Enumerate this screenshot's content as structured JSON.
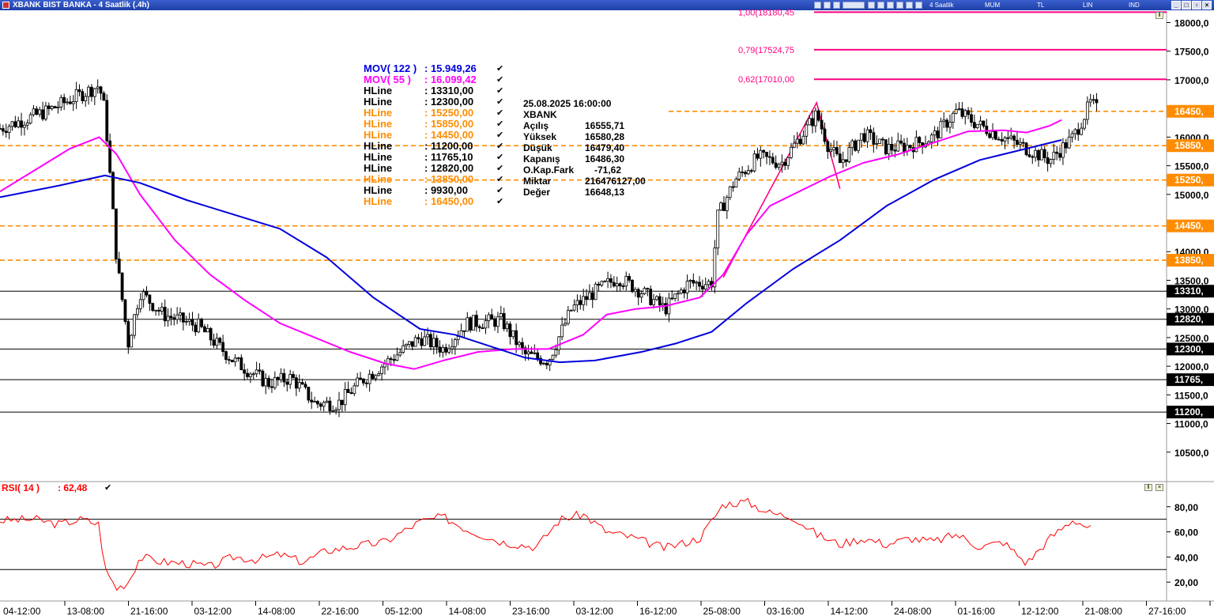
{
  "window": {
    "title": "XBANK BIST BANKA - 4 Saatlik (.4h)",
    "toolbar": [
      "4 Saatlik",
      "MUM",
      "TL",
      "LIN",
      "IND"
    ]
  },
  "colors": {
    "mov122": "#0000dd",
    "mov55": "#ff00ff",
    "hline_black": "#000000",
    "hline_orange": "#ff8c00",
    "fib": "#ff0080",
    "rsi": "#ff0000",
    "candle_up": "#ffffff",
    "candle_down": "#000000"
  },
  "legend": {
    "mov122_label": "MOV( 122 )",
    "mov122_value": ": 15.949,26",
    "mov55_label": "MOV( 55 )",
    "mov55_value": ": 16.099,42",
    "hlines": [
      {
        "label": "HLine",
        "value": ": 13310,00",
        "color": "black"
      },
      {
        "label": "HLine",
        "value": ": 12300,00",
        "color": "black"
      },
      {
        "label": "HLine",
        "value": ": 15250,00",
        "color": "orange"
      },
      {
        "label": "HLine",
        "value": ": 15850,00",
        "color": "orange"
      },
      {
        "label": "HLine",
        "value": ": 14450,00",
        "color": "orange"
      },
      {
        "label": "HLine",
        "value": ": 11200,00",
        "color": "black"
      },
      {
        "label": "HLine",
        "value": ": 11765,10",
        "color": "black"
      },
      {
        "label": "HLine",
        "value": ": 12820,00",
        "color": "black"
      },
      {
        "label": "HLine",
        "value": ": 13850,00",
        "color": "orange"
      },
      {
        "label": "HLine",
        "value": ": 9930,00",
        "color": "black"
      },
      {
        "label": "HLine",
        "value": ": 16450,00",
        "color": "orange"
      }
    ]
  },
  "info": {
    "datetime": "25.08.2025  16:00:00",
    "symbol": "XBANK",
    "rows": [
      {
        "label": "Açılış",
        "value": "16555,71"
      },
      {
        "label": "Yüksek",
        "value": "16580,28"
      },
      {
        "label": "Düşük",
        "value": "16479,40"
      },
      {
        "label": "Kapanış",
        "value": "16486,30"
      },
      {
        "label": "O.Kap.Fark",
        "value": "-71,62"
      },
      {
        "label": "Miktar",
        "value": "216476127,00"
      },
      {
        "label": "Değer",
        "value": "16648,13"
      }
    ]
  },
  "rsi": {
    "label": "RSI( 14 )",
    "value": ": 62,48"
  },
  "chart_data": {
    "type": "candlestick",
    "price_axis": {
      "min": 10000,
      "max": 18200,
      "ticks": [
        {
          "value": 18000,
          "label": "18000,0"
        },
        {
          "value": 17500,
          "label": "17500,0"
        },
        {
          "value": 17000,
          "label": "17000,0"
        },
        {
          "value": 16500,
          "label": "16500,0"
        },
        {
          "value": 16000,
          "label": "16000,0"
        },
        {
          "value": 15500,
          "label": "15500,0"
        },
        {
          "value": 15000,
          "label": "15000,0"
        },
        {
          "value": 14500,
          "label": "14500,0"
        },
        {
          "value": 14000,
          "label": "14000,0"
        },
        {
          "value": 13500,
          "label": "13500,0"
        },
        {
          "value": 13000,
          "label": "13000,0"
        },
        {
          "value": 12500,
          "label": "12500,0"
        },
        {
          "value": 12000,
          "label": "12000,0"
        },
        {
          "value": 11500,
          "label": "11500,0"
        },
        {
          "value": 11000,
          "label": "11000,0"
        },
        {
          "value": 10500,
          "label": "10500,0"
        }
      ]
    },
    "x_labels": [
      "04-12:00",
      "13-08:00",
      "21-16:00",
      "03-12:00",
      "14-08:00",
      "22-16:00",
      "05-12:00",
      "14-08:00",
      "23-16:00",
      "03-12:00",
      "16-12:00",
      "25-08:00",
      "03-16:00",
      "14-12:00",
      "24-08:00",
      "01-16:00",
      "12-12:00",
      "21-08:00",
      "27-16:00"
    ],
    "horizontal_lines": [
      {
        "value": 16450,
        "label": "16450,",
        "color": "orange"
      },
      {
        "value": 15850,
        "label": "15850,",
        "color": "orange"
      },
      {
        "value": 15250,
        "label": "15250,",
        "color": "orange"
      },
      {
        "value": 14450,
        "label": "14450,",
        "color": "orange"
      },
      {
        "value": 13850,
        "label": "13850,",
        "color": "orange"
      },
      {
        "value": 13310,
        "label": "13310,",
        "color": "black"
      },
      {
        "value": 12820,
        "label": "12820,",
        "color": "black"
      },
      {
        "value": 12300,
        "label": "12300,",
        "color": "black"
      },
      {
        "value": 11765.1,
        "label": "11765,",
        "color": "black"
      },
      {
        "value": 11200,
        "label": "11200,",
        "color": "black"
      }
    ],
    "fibonacci": [
      {
        "value": 18180.45,
        "label": "1,00(18180,45"
      },
      {
        "value": 17524.75,
        "label": "0,79(17524,75"
      },
      {
        "value": 17010,
        "label": "0,62(17010,00"
      }
    ],
    "close_path": [
      [
        0,
        16150
      ],
      [
        0.04,
        16450
      ],
      [
        0.07,
        16750
      ],
      [
        0.085,
        16900
      ],
      [
        0.09,
        16450
      ],
      [
        0.1,
        13850
      ],
      [
        0.11,
        12400
      ],
      [
        0.12,
        13300
      ],
      [
        0.14,
        12900
      ],
      [
        0.17,
        12700
      ],
      [
        0.2,
        12100
      ],
      [
        0.23,
        11700
      ],
      [
        0.25,
        11800
      ],
      [
        0.27,
        11350
      ],
      [
        0.29,
        11350
      ],
      [
        0.31,
        11750
      ],
      [
        0.34,
        12200
      ],
      [
        0.36,
        12500
      ],
      [
        0.38,
        12300
      ],
      [
        0.4,
        12750
      ],
      [
        0.43,
        12800
      ],
      [
        0.45,
        12200
      ],
      [
        0.47,
        12100
      ],
      [
        0.49,
        13000
      ],
      [
        0.51,
        13300
      ],
      [
        0.53,
        13550
      ],
      [
        0.55,
        13300
      ],
      [
        0.57,
        13000
      ],
      [
        0.59,
        13450
      ],
      [
        0.61,
        13450
      ],
      [
        0.615,
        14600
      ],
      [
        0.63,
        15250
      ],
      [
        0.65,
        15650
      ],
      [
        0.67,
        15550
      ],
      [
        0.7,
        16400
      ],
      [
        0.71,
        15850
      ],
      [
        0.72,
        15550
      ],
      [
        0.74,
        16050
      ],
      [
        0.76,
        15800
      ],
      [
        0.78,
        15850
      ],
      [
        0.8,
        16000
      ],
      [
        0.82,
        16450
      ],
      [
        0.84,
        16200
      ],
      [
        0.86,
        16000
      ],
      [
        0.88,
        15800
      ],
      [
        0.9,
        15600
      ],
      [
        0.92,
        16000
      ],
      [
        0.935,
        16600
      ],
      [
        0.94,
        16486
      ]
    ],
    "mov122_path": [
      [
        0,
        14950
      ],
      [
        0.05,
        15150
      ],
      [
        0.09,
        15330
      ],
      [
        0.12,
        15200
      ],
      [
        0.16,
        14900
      ],
      [
        0.2,
        14650
      ],
      [
        0.24,
        14400
      ],
      [
        0.28,
        13900
      ],
      [
        0.32,
        13200
      ],
      [
        0.36,
        12650
      ],
      [
        0.39,
        12550
      ],
      [
        0.42,
        12350
      ],
      [
        0.45,
        12150
      ],
      [
        0.48,
        12070
      ],
      [
        0.51,
        12100
      ],
      [
        0.55,
        12250
      ],
      [
        0.58,
        12400
      ],
      [
        0.61,
        12600
      ],
      [
        0.64,
        13100
      ],
      [
        0.68,
        13700
      ],
      [
        0.72,
        14200
      ],
      [
        0.76,
        14800
      ],
      [
        0.8,
        15250
      ],
      [
        0.84,
        15600
      ],
      [
        0.88,
        15800
      ],
      [
        0.91,
        15949.26
      ]
    ],
    "mov55_path": [
      [
        0,
        15050
      ],
      [
        0.04,
        15550
      ],
      [
        0.06,
        15800
      ],
      [
        0.085,
        16000
      ],
      [
        0.1,
        15700
      ],
      [
        0.12,
        15000
      ],
      [
        0.15,
        14200
      ],
      [
        0.18,
        13600
      ],
      [
        0.21,
        13150
      ],
      [
        0.24,
        12750
      ],
      [
        0.27,
        12500
      ],
      [
        0.3,
        12250
      ],
      [
        0.33,
        12050
      ],
      [
        0.355,
        11950
      ],
      [
        0.38,
        12100
      ],
      [
        0.41,
        12250
      ],
      [
        0.44,
        12300
      ],
      [
        0.47,
        12300
      ],
      [
        0.5,
        12550
      ],
      [
        0.52,
        12900
      ],
      [
        0.545,
        13000
      ],
      [
        0.57,
        13050
      ],
      [
        0.6,
        13200
      ],
      [
        0.62,
        13600
      ],
      [
        0.64,
        14300
      ],
      [
        0.66,
        14800
      ],
      [
        0.69,
        15100
      ],
      [
        0.71,
        15300
      ],
      [
        0.74,
        15550
      ],
      [
        0.77,
        15700
      ],
      [
        0.8,
        15900
      ],
      [
        0.83,
        16100
      ],
      [
        0.86,
        16120
      ],
      [
        0.88,
        16080
      ],
      [
        0.9,
        16200
      ],
      [
        0.91,
        16300
      ]
    ],
    "rsi_axis": {
      "min": 5,
      "max": 100,
      "ticks": [
        {
          "value": 80,
          "label": "80,00"
        },
        {
          "value": 60,
          "label": "60,00"
        },
        {
          "value": 40,
          "label": "40,00"
        },
        {
          "value": 20,
          "label": "20,00"
        }
      ],
      "levels": [
        70,
        30
      ]
    },
    "rsi_path": [
      [
        0,
        69
      ],
      [
        0.03,
        70
      ],
      [
        0.05,
        66
      ],
      [
        0.07,
        70
      ],
      [
        0.085,
        66
      ],
      [
        0.09,
        30
      ],
      [
        0.1,
        15
      ],
      [
        0.11,
        20
      ],
      [
        0.12,
        40
      ],
      [
        0.14,
        36
      ],
      [
        0.16,
        35
      ],
      [
        0.18,
        32
      ],
      [
        0.2,
        40
      ],
      [
        0.22,
        38
      ],
      [
        0.24,
        42
      ],
      [
        0.26,
        36
      ],
      [
        0.28,
        45
      ],
      [
        0.3,
        48
      ],
      [
        0.33,
        52
      ],
      [
        0.36,
        68
      ],
      [
        0.38,
        72
      ],
      [
        0.4,
        62
      ],
      [
        0.43,
        52
      ],
      [
        0.46,
        48
      ],
      [
        0.48,
        70
      ],
      [
        0.5,
        74
      ],
      [
        0.52,
        60
      ],
      [
        0.54,
        56
      ],
      [
        0.57,
        47
      ],
      [
        0.6,
        55
      ],
      [
        0.62,
        82
      ],
      [
        0.64,
        84
      ],
      [
        0.66,
        75
      ],
      [
        0.68,
        72
      ],
      [
        0.7,
        58
      ],
      [
        0.72,
        50
      ],
      [
        0.74,
        55
      ],
      [
        0.76,
        50
      ],
      [
        0.78,
        55
      ],
      [
        0.8,
        52
      ],
      [
        0.82,
        58
      ],
      [
        0.84,
        48
      ],
      [
        0.86,
        52
      ],
      [
        0.88,
        35
      ],
      [
        0.9,
        55
      ],
      [
        0.92,
        70
      ],
      [
        0.935,
        62.48
      ]
    ]
  }
}
